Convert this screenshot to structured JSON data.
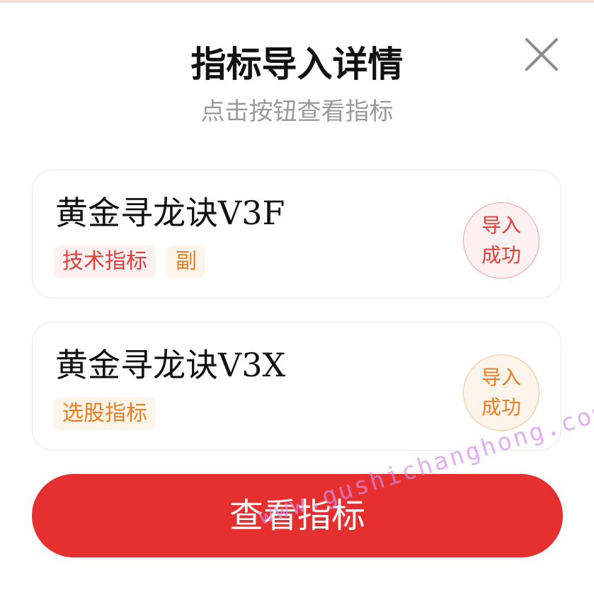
{
  "modal": {
    "title": "指标导入详情",
    "subtitle": "点击按钮查看指标"
  },
  "close_icon": "close-icon",
  "indicators": [
    {
      "name": "黄金寻龙诀V3F",
      "tags": [
        "技术指标",
        "副"
      ],
      "status_line1": "导入",
      "status_line2": "成功",
      "status_color": "#e0403a"
    },
    {
      "name": "黄金寻龙诀V3X",
      "tags": [
        "选股指标"
      ],
      "status_line1": "导入",
      "status_line2": "成功",
      "status_color": "#ee7d1f"
    }
  ],
  "view_button": {
    "label": "查看指标"
  },
  "watermark": "www.gushichanghong.com",
  "colors": {
    "primary": "#e6302f",
    "red_tag": "#e0403a",
    "orange_tag": "#ee7d1f"
  }
}
